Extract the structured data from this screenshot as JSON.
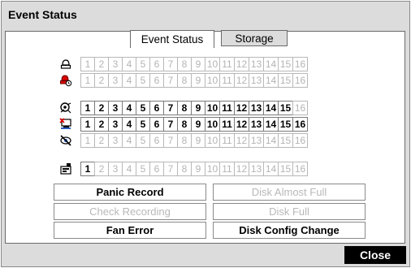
{
  "dialog": {
    "title": "Event Status"
  },
  "tabs": [
    {
      "label": "Event Status",
      "active": true
    },
    {
      "label": "Storage",
      "active": false
    }
  ],
  "rows": [
    {
      "icon": "alarm-in-icon",
      "cells": [
        "1",
        "2",
        "3",
        "4",
        "5",
        "6",
        "7",
        "8",
        "9",
        "10",
        "11",
        "12",
        "13",
        "14",
        "15",
        "16"
      ],
      "active": []
    },
    {
      "icon": "alarm-out-icon",
      "cells": [
        "1",
        "2",
        "3",
        "4",
        "5",
        "6",
        "7",
        "8",
        "9",
        "10",
        "11",
        "12",
        "13",
        "14",
        "15",
        "16"
      ],
      "active": []
    },
    {
      "icon": "motion-icon",
      "cells": [
        "1",
        "2",
        "3",
        "4",
        "5",
        "6",
        "7",
        "8",
        "9",
        "10",
        "11",
        "12",
        "13",
        "14",
        "15",
        "16"
      ],
      "active": [
        1,
        2,
        3,
        4,
        5,
        6,
        7,
        8,
        9,
        10,
        11,
        12,
        13,
        14,
        15
      ]
    },
    {
      "icon": "video-loss-icon",
      "cells": [
        "1",
        "2",
        "3",
        "4",
        "5",
        "6",
        "7",
        "8",
        "9",
        "10",
        "11",
        "12",
        "13",
        "14",
        "15",
        "16"
      ],
      "active": [
        1,
        2,
        3,
        4,
        5,
        6,
        7,
        8,
        9,
        10,
        11,
        12,
        13,
        14,
        15,
        16
      ]
    },
    {
      "icon": "tampering-icon",
      "cells": [
        "1",
        "2",
        "3",
        "4",
        "5",
        "6",
        "7",
        "8",
        "9",
        "10",
        "11",
        "12",
        "13",
        "14",
        "15",
        "16"
      ],
      "active": []
    },
    {
      "icon": "text-in-icon",
      "cells": [
        "1",
        "2",
        "3",
        "4",
        "5",
        "6",
        "7",
        "8",
        "9",
        "10",
        "11",
        "12",
        "13",
        "14",
        "15",
        "16"
      ],
      "active": [
        1
      ]
    }
  ],
  "status": {
    "panic_record": "Panic Record",
    "disk_almost_full": "Disk Almost Full",
    "check_recording": "Check Recording",
    "disk_full": "Disk Full",
    "fan_error": "Fan Error",
    "disk_config_change": "Disk Config Change"
  },
  "footer": {
    "close_label": "Close"
  },
  "colors": {
    "dialog_bg": "#dcdcdc",
    "close_bg": "#000000",
    "inactive_text": "#b4b4b4"
  }
}
